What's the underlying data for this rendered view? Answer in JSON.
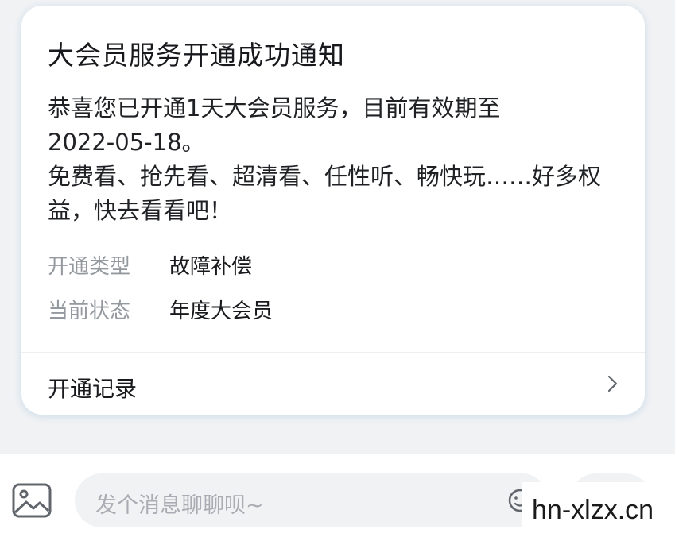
{
  "card": {
    "title": "大会员服务开通成功通知",
    "message_lines": [
      "恭喜您已开通1天大会员服务，目前有效期至",
      "2022-05-18。",
      "免费看、抢先看、超清看、任性听、畅快玩……好多权",
      "益，快去看看吧！"
    ],
    "fields": [
      {
        "label": "开通类型",
        "value": "故障补偿"
      },
      {
        "label": "当前状态",
        "value": "年度大会员"
      }
    ],
    "record_label": "开通记录"
  },
  "bottom_bar": {
    "image_icon": "image-icon",
    "input_placeholder": "发个消息聊聊呗~",
    "emoji_icon": "emoji-icon"
  },
  "watermark": "hn-xlzx.cn"
}
